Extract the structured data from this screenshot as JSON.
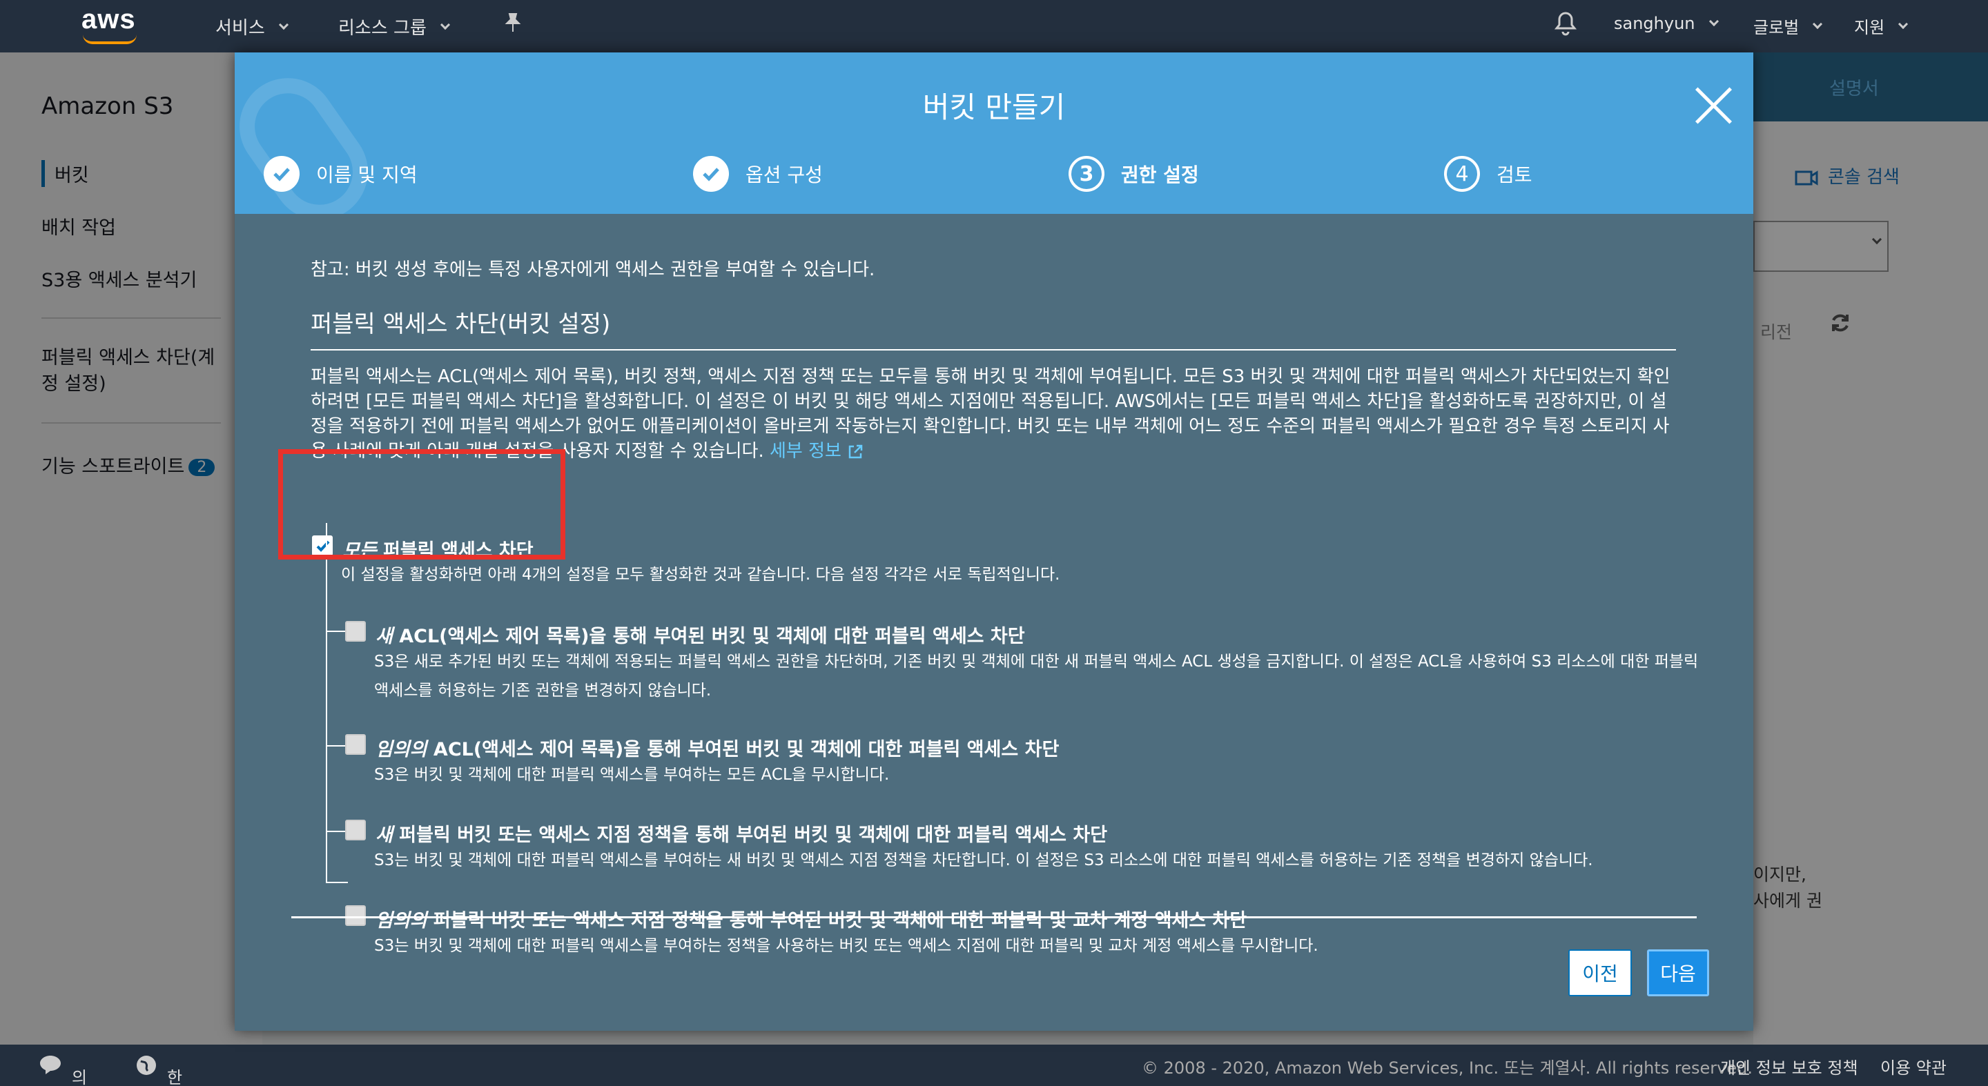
{
  "topnav": {
    "logo": "aws",
    "services": "서비스",
    "resource_groups": "리소스 그룹",
    "user": "sanghyun",
    "region": "글로벌",
    "support": "지원"
  },
  "sidebar": {
    "title": "Amazon S3",
    "items": [
      {
        "label": "버킷"
      },
      {
        "label": "배치 작업"
      },
      {
        "label": "S3용 액세스 분석기"
      },
      {
        "label": "퍼블릭 액세스 차단(계정 설정)"
      },
      {
        "label": "기능 스포트라이트",
        "badge": "2"
      }
    ]
  },
  "right_panel": {
    "doc_link": "설명서",
    "console_search": "콘솔 검색",
    "region_fragment": "리전",
    "text_frag1": "이지만,",
    "text_frag2": "사에게 권"
  },
  "modal": {
    "title": "버킷 만들기",
    "steps": [
      {
        "num": "1",
        "label": "이름 및 지역",
        "state": "done"
      },
      {
        "num": "2",
        "label": "옵션 구성",
        "state": "done"
      },
      {
        "num": "3",
        "label": "권한 설정",
        "state": "current"
      },
      {
        "num": "4",
        "label": "검토",
        "state": "todo"
      }
    ],
    "note": "참고: 버킷 생성 후에는 특정 사용자에게 액세스 권한을 부여할 수 있습니다.",
    "section_title": "퍼블릭 액세스 차단(버킷 설정)",
    "description": "퍼블릭 액세스는 ACL(액세스 제어 목록), 버킷 정책, 액세스 지점 정책 또는 모두를 통해 버킷 및 객체에 부여됩니다. 모든 S3 버킷 및 객체에 대한 퍼블릭 액세스가 차단되었는지 확인하려면 [모든 퍼블릭 액세스 차단]을 활성화합니다. 이 설정은 이 버킷 및 해당 액세스 지점에만 적용됩니다. AWS에서는 [모든 퍼블릭 액세스 차단]을 활성화하도록 권장하지만, 이 설정을 적용하기 전에 퍼블릭 액세스가 없어도 애플리케이션이 올바르게 작동하는지 확인합니다. 버킷 또는 내부 객체에 어느 정도 수준의 퍼블릭 액세스가 필요한 경우 특정 스토리지 사용 사례에 맞게 아래 개별 설정을 사용자 지정할 수 있습니다.",
    "more_info": "세부 정보",
    "block_all": {
      "title_em": "모든",
      "title_rest": " 퍼블릭 액세스 차단",
      "checked": true,
      "sub": "이 설정을 활성화하면 아래 4개의 설정을 모두 활성화한 것과 같습니다. 다음 설정 각각은 서로 독립적입니다."
    },
    "options": [
      {
        "em": "새",
        "rest": " ACL(액세스 제어 목록)을 통해 부여된 버킷 및 객체에 대한 퍼블릭 액세스 차단",
        "sub1": "S3은 새로 추가된 버킷 또는 객체에 적용되는 퍼블릭 액세스 권한을 차단하며, 기존 버킷 및 객체에 대한 새 퍼블릭 액세스 ACL 생성을 금지합니다. 이 설정은 ACL을 사용하여 S3 리소스에 대한 퍼블릭",
        "sub2": "액세스를 허용하는 기존 권한을 변경하지 않습니다."
      },
      {
        "em": "임의의",
        "rest": " ACL(액세스 제어 목록)을 통해 부여된 버킷 및 객체에 대한 퍼블릭 액세스 차단",
        "sub1": "S3은 버킷 및 객체에 대한 퍼블릭 액세스를 부여하는 모든 ACL을 무시합니다."
      },
      {
        "em": "새",
        "rest": " 퍼블릭 버킷 또는 액세스 지점 정책을 통해 부여된 버킷 및 객체에 대한 퍼블릭 액세스 차단",
        "sub1": "S3는 버킷 및 객체에 대한 퍼블릭 액세스를 부여하는 새 버킷 및 액세스 지점 정책을 차단합니다. 이 설정은 S3 리소스에 대한 퍼블릭 액세스를 허용하는 기존 정책을 변경하지 않습니다."
      },
      {
        "em": "임의의",
        "rest": " 퍼블릭 버킷 또는 액세스 지점 정책을 통해 부여된 버킷 및 객체에 대한 퍼블릭 및 교차 계정 액세스 차단",
        "sub1": "S3는 버킷 및 객체에 대한 퍼블릭 액세스를 부여하는 정책을 사용하는 버킷 또는 액세스 지점에 대한 퍼블릭 및 교차 계정 액세스를 무시합니다."
      }
    ],
    "btn_prev": "이전",
    "btn_next": "다음"
  },
  "footer": {
    "feedback": "의견",
    "language": "한국어",
    "copyright": "© 2008 - 2020, Amazon Web Services, Inc. 또는 계열사. All rights reserved.",
    "privacy": "개인 정보 보호 정책",
    "terms": "이용 약관"
  },
  "colors": {
    "nav": "#232f3e",
    "header": "#4aa3db",
    "modal_body": "#4e6d7e",
    "accent": "#0073bb",
    "highlight": "#e8322b"
  }
}
